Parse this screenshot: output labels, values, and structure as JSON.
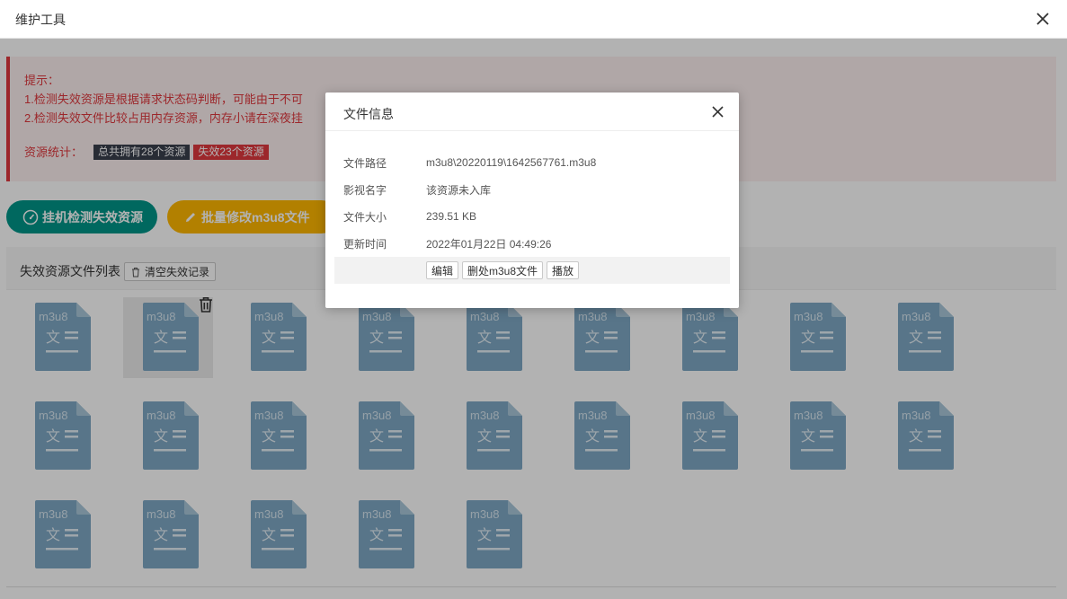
{
  "window": {
    "title": "维护工具"
  },
  "notice": {
    "heading": "提示：",
    "line1": "1.检测失效资源是根据请求状态码判断，可能由于不可",
    "line2": "2.检测失效文件比较占用内存资源，内存小请在深夜挂",
    "stats_label": "资源统计：",
    "total_badge": "总共拥有28个资源",
    "invalid_badge": "失效23个资源"
  },
  "actions": {
    "scan_button": "挂机检测失效资源",
    "batch_button": "批量修改m3u8文件"
  },
  "list": {
    "title": "失效资源文件列表",
    "clear_button": "清空失效记录",
    "file_icon_label": "m3u8",
    "file_icon_glyph": "文",
    "file_count": 23
  },
  "dialog": {
    "title": "文件信息",
    "rows": [
      {
        "key": "文件路径",
        "value": "m3u8\\20220119\\1642567761.m3u8"
      },
      {
        "key": "影视名字",
        "value": "该资源未入库"
      },
      {
        "key": "文件大小",
        "value": "239.51 KB"
      },
      {
        "key": "更新时间",
        "value": "2022年01月22日 04:49:26"
      }
    ],
    "edit_button": "编辑",
    "delete_button": "删处m3u8文件",
    "play_button": "播放"
  },
  "colors": {
    "primary_green": "#009688",
    "warn_yellow": "#ffb800",
    "danger_red": "#e0393e",
    "dark_badge": "#3a3f4d",
    "file_icon": "#7fa8c4"
  }
}
